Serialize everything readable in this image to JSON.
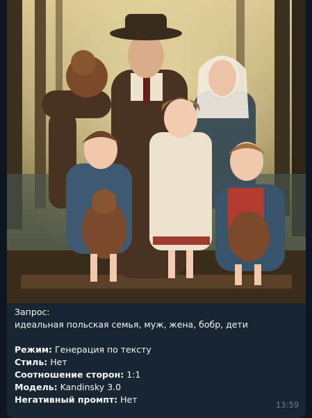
{
  "message": {
    "image_alt": "AI-generated painting of a Polish family with beavers in a forest",
    "request_label": "Запрос:",
    "request_text": "идеальная польская семья, муж, жена, бобр, дети",
    "fields": [
      {
        "label": "Режим:",
        "value": "Генерация по тексту"
      },
      {
        "label": "Стиль:",
        "value": "Нет"
      },
      {
        "label": "Соотношение сторон:",
        "value": "1:1"
      },
      {
        "label": "Модель:",
        "value": "Kandinsky 3.0"
      },
      {
        "label": "Негативный промпт:",
        "value": "Нет"
      }
    ],
    "time": "13:59"
  },
  "colors": {
    "chat_bg": "#0e1621",
    "bubble_bg": "#182533",
    "text": "#f5f5f5",
    "time": "#6d7f8f"
  }
}
